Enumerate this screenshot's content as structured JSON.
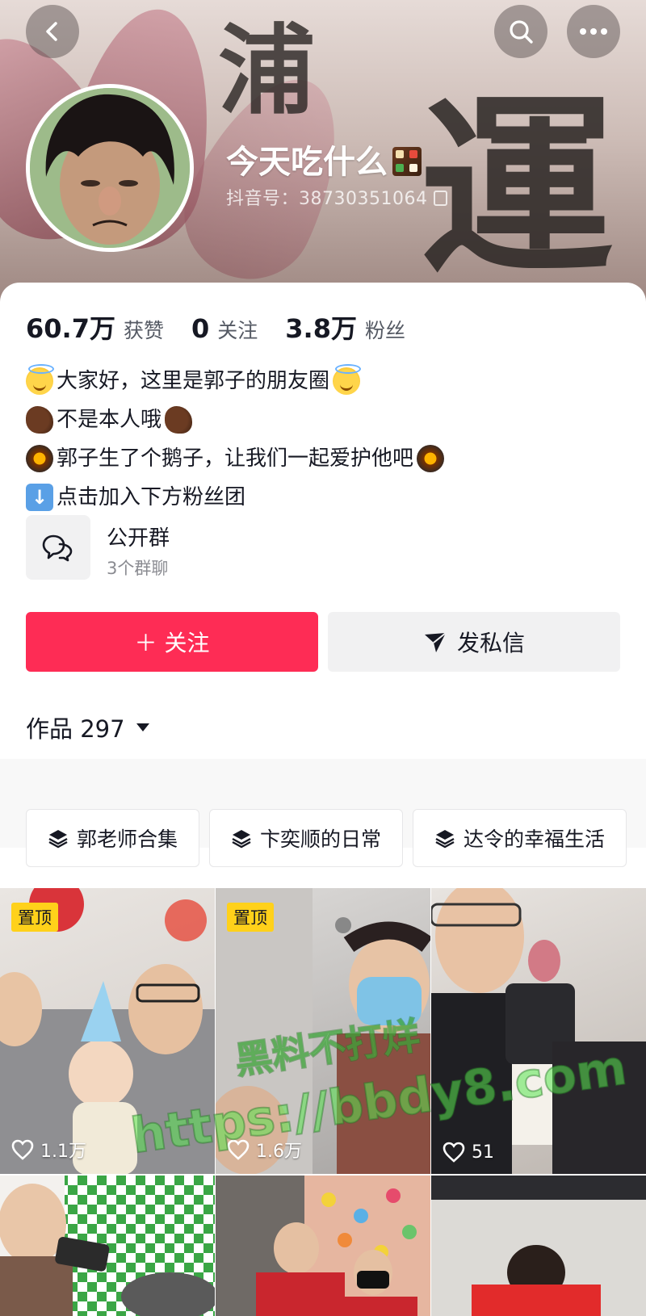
{
  "header": {
    "nickname": "今天吃什么",
    "douyin_id": "抖音号：38730351064",
    "brush_chars": [
      "浦",
      "運"
    ]
  },
  "icons": {
    "back": "chevron-left-icon",
    "search": "search-icon",
    "more": "more-icon",
    "copy": "copy-icon"
  },
  "stats": [
    {
      "num": "60.7万",
      "label": "获赞"
    },
    {
      "num": "0",
      "label": "关注"
    },
    {
      "num": "3.8万",
      "label": "粉丝"
    }
  ],
  "bio": [
    {
      "emoji": "halo-smile",
      "text": "大家好，这里是郭子的朋友圈",
      "emoji_end": "halo-smile"
    },
    {
      "emoji": "boar",
      "text": "不是本人哦",
      "emoji_end": "boar"
    },
    {
      "emoji": "pan",
      "text": "郭子生了个鹅子，让我们一起爱护他吧",
      "emoji_end": "pan"
    },
    {
      "emoji": "down-arrow",
      "text": "点击加入下方粉丝团",
      "emoji_end": ""
    }
  ],
  "group": {
    "title": "公开群",
    "subtitle": "3个群聊"
  },
  "buttons": {
    "follow": "＋ 关注",
    "message": "发私信"
  },
  "works": {
    "label": "作品 297"
  },
  "collections": [
    "郭老师合集",
    "卞奕顺的日常",
    "达令的幸福生活"
  ],
  "videos": [
    {
      "pinned": "置顶",
      "likes": "1.1万"
    },
    {
      "pinned": "置顶",
      "likes": "1.6万"
    },
    {
      "pinned": "",
      "likes": "51"
    },
    {
      "pinned": "",
      "likes": ""
    },
    {
      "pinned": "",
      "likes": ""
    },
    {
      "pinned": "",
      "likes": ""
    }
  ],
  "watermark": {
    "line1": "黑料不打烊",
    "line2": "https://bbdy8.com"
  },
  "colors": {
    "accent": "#fe2c55",
    "pin_badge": "#ffd11a",
    "secondary_button": "#f1f1f2"
  }
}
